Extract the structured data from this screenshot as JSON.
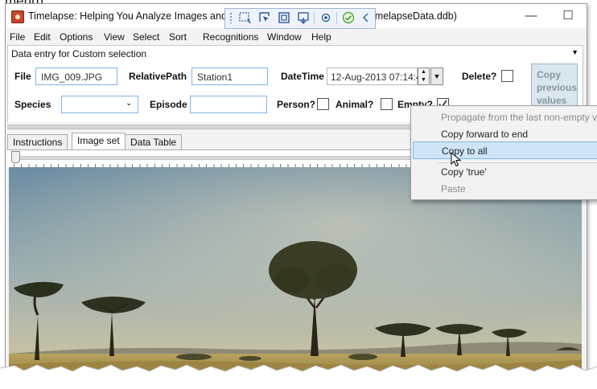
{
  "caption": "menu).",
  "window": {
    "title_left": "Timelapse: Helping You Analyze Images and Vi",
    "title_right": "imelapseData.ddb)",
    "controls": {
      "minimize": "—",
      "maximize": "☐",
      "close": "✕"
    }
  },
  "menu": [
    "File",
    "Edit",
    "Options",
    "View",
    "Select",
    "Sort",
    "Recognitions",
    "Window",
    "Help"
  ],
  "data_entry": {
    "header": "Data entry for Custom selection",
    "file_label": "File",
    "file_value": "IMG_009.JPG",
    "relpath_label": "RelativePath",
    "relpath_value": "Station1",
    "datetime_label": "DateTime",
    "datetime_value": "12-Aug-2013 07:14:45",
    "delete_label": "Delete?",
    "copy_button": "Copy previous values",
    "species_label": "Species",
    "species_value": "",
    "episode_label": "Episode",
    "episode_value": "",
    "person_label": "Person?",
    "animal_label": "Animal?",
    "empty_label": "Empty?",
    "empty_checked": true
  },
  "tabs": [
    "Instructions",
    "Image set",
    "Data Table"
  ],
  "active_tab": "Image set",
  "context_menu": {
    "items": [
      {
        "label": "Propagate from the last non-empty value",
        "enabled": false
      },
      {
        "label": "Copy forward to end",
        "enabled": true
      },
      {
        "label": "Copy to all",
        "enabled": true,
        "highlighted": true
      },
      {
        "label": "Copy 'true'",
        "enabled": true
      },
      {
        "label": "Paste",
        "enabled": false
      }
    ]
  },
  "colors": {
    "sky_top": "#6f8fa6",
    "sky_bottom": "#c9c2a4",
    "grass": "#b39a58",
    "highlight": "#cfe5f7"
  }
}
